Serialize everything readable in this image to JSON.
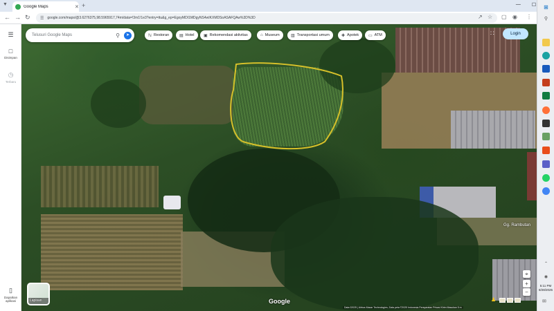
{
  "browser": {
    "tab_title": "Google Maps",
    "new_tab_symbol": "+",
    "url": "google.com/maps/@3.6276375,98.5965917,74m/data=!3m1!1e3?entry=ttu&g_ep=EgoyMDI1MDgyNS4wIKXMDSoASAFQAw%3D%3D",
    "window_controls": [
      "—",
      "☐",
      "✕"
    ]
  },
  "rail": {
    "saved_label": "Disimpan",
    "recents_label": "Terbaru",
    "download_label": "Dapatkan aplikasi"
  },
  "search": {
    "placeholder": "Telusuri Google Maps"
  },
  "chips": [
    {
      "icon": "ℕ",
      "label": "Restoran"
    },
    {
      "icon": "▤",
      "label": "Hotel"
    },
    {
      "icon": "▣",
      "label": "Rekomendasi aktivitas"
    },
    {
      "icon": "⌂",
      "label": "Museum"
    },
    {
      "icon": "▥",
      "label": "Transportasi umum"
    },
    {
      "icon": "✚",
      "label": "Apotek"
    },
    {
      "icon": "▭",
      "label": "ATM"
    }
  ],
  "login_label": "Login",
  "layers_label": "Lapisan",
  "google_logo": "Google",
  "street_label": "Gg. Rambutan",
  "attribution": "Data 02025 | Airbus Maxar Technologies, Data peta ©2025   Indonesia   Persyaratan   Privasi   Kirim Masukan   5 m",
  "clock": {
    "time": "5:11 PM",
    "date": "8/28/2025"
  },
  "colors": {
    "field_outline": "#d6c02a",
    "login_bg": "#c2e7ff",
    "accent": "#1a73e8"
  }
}
